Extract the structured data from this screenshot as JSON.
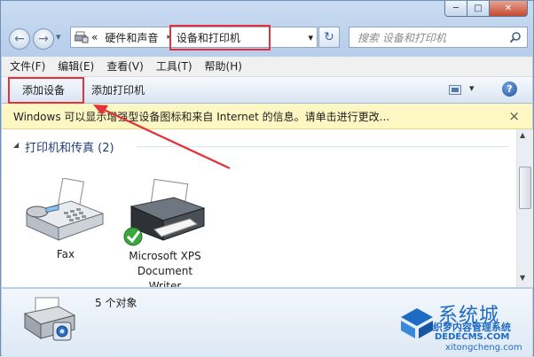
{
  "nav": {
    "back_arrow": "←",
    "forward_arrow": "→",
    "history": "▾"
  },
  "address": {
    "chevrons": "«",
    "parent": "硬件和声音",
    "separator": "▸",
    "current": "设备和打印机",
    "dropdown": "▾",
    "refresh": "↻"
  },
  "search": {
    "placeholder": "搜索 设备和打印机"
  },
  "menu": [
    {
      "label": "文件(F)"
    },
    {
      "label": "编辑(E)"
    },
    {
      "label": "查看(V)"
    },
    {
      "label": "工具(T)"
    },
    {
      "label": "帮助(H)"
    }
  ],
  "toolbar": {
    "add_device": "添加设备",
    "add_printer": "添加打印机",
    "view_caret": "▾",
    "help": "?"
  },
  "infobar": {
    "text": "Windows 可以显示增强型设备图标和来自 Internet 的信息。请单击进行更改...",
    "close": "×"
  },
  "group": {
    "arrow": "◢",
    "title": "打印机和传真 (2)"
  },
  "devices": [
    {
      "name": "Fax",
      "icon": "fax-icon"
    },
    {
      "name": "Microsoft XPS Document Writer",
      "name_lines": [
        "Microsoft XPS",
        "Document",
        "Writer"
      ],
      "icon": "printer-icon",
      "default": true
    }
  ],
  "details": {
    "count": "5 个对象"
  },
  "watermark": {
    "brand": "系统城",
    "sub": "织梦内容管理系统",
    "domain": "DEDECMS.COM",
    "url": "xitongcheng.com"
  },
  "colors": {
    "highlight_box": "#e4323a",
    "infobar_bg": "#fdf7c3",
    "group_title": "#1e3e78",
    "watermark_blue": "#1e6bc4"
  }
}
